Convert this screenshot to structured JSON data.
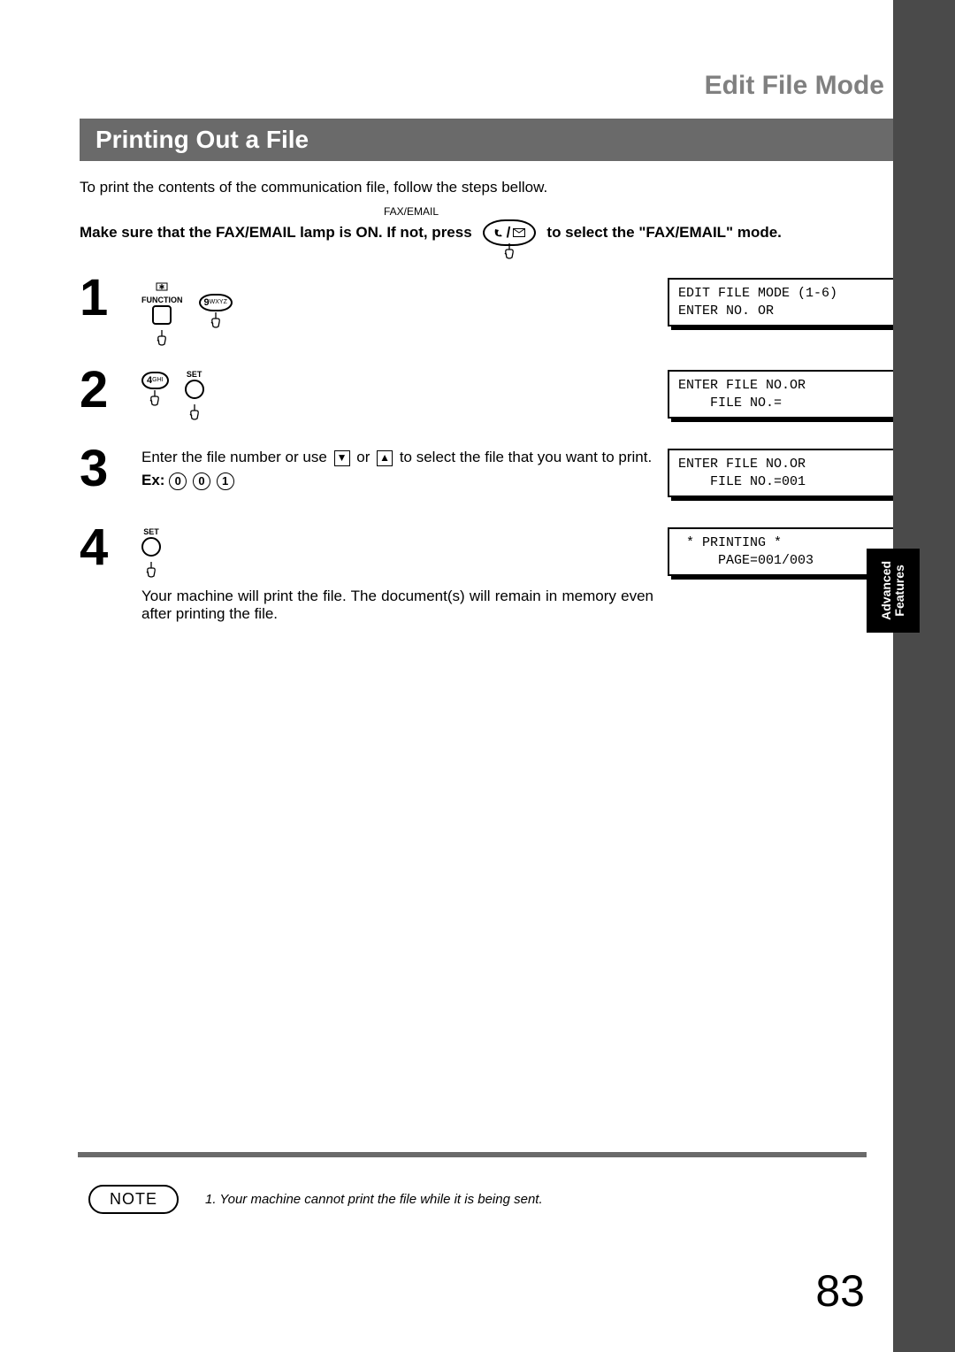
{
  "header": {
    "title": "Edit File Mode",
    "section": "Printing Out a File"
  },
  "side_tab": {
    "line1": "Advanced",
    "line2": "Features"
  },
  "intro": "To print the contents of the communication file, follow the steps bellow.",
  "fax_email": {
    "small_label": "FAX/EMAIL",
    "pre_text": "Make sure that the FAX/EMAIL lamp is ON.  If not, press",
    "post_text": "to select the \"FAX/EMAIL\" mode."
  },
  "steps": [
    {
      "num": "1",
      "buttons": {
        "function_label": "FUNCTION",
        "key9_main": "9",
        "key9_sub": "WXYZ"
      },
      "lcd": "EDIT FILE MODE (1-6)\nENTER NO. OR "
    },
    {
      "num": "2",
      "buttons": {
        "key4_main": "4",
        "key4_sub": "GHI",
        "set_label": "SET"
      },
      "lcd": "ENTER FILE NO.OR \n    FILE NO.="
    },
    {
      "num": "3",
      "text_before": "Enter the file number or use ",
      "text_mid": " or ",
      "text_after": " to select the file that you want to print.",
      "ex_label": "Ex:",
      "ex_keys": [
        "0",
        "0",
        "1"
      ],
      "lcd": "ENTER FILE NO.OR \n    FILE NO.=001"
    },
    {
      "num": "4",
      "buttons": {
        "set_label": "SET"
      },
      "text": "Your machine will print the file.  The document(s) will remain in memory even after printing the file.",
      "lcd": " * PRINTING *\n     PAGE=001/003"
    }
  ],
  "note": {
    "label": "NOTE",
    "text": "1.  Your machine cannot print the file while it is being sent."
  },
  "page_number": "83"
}
